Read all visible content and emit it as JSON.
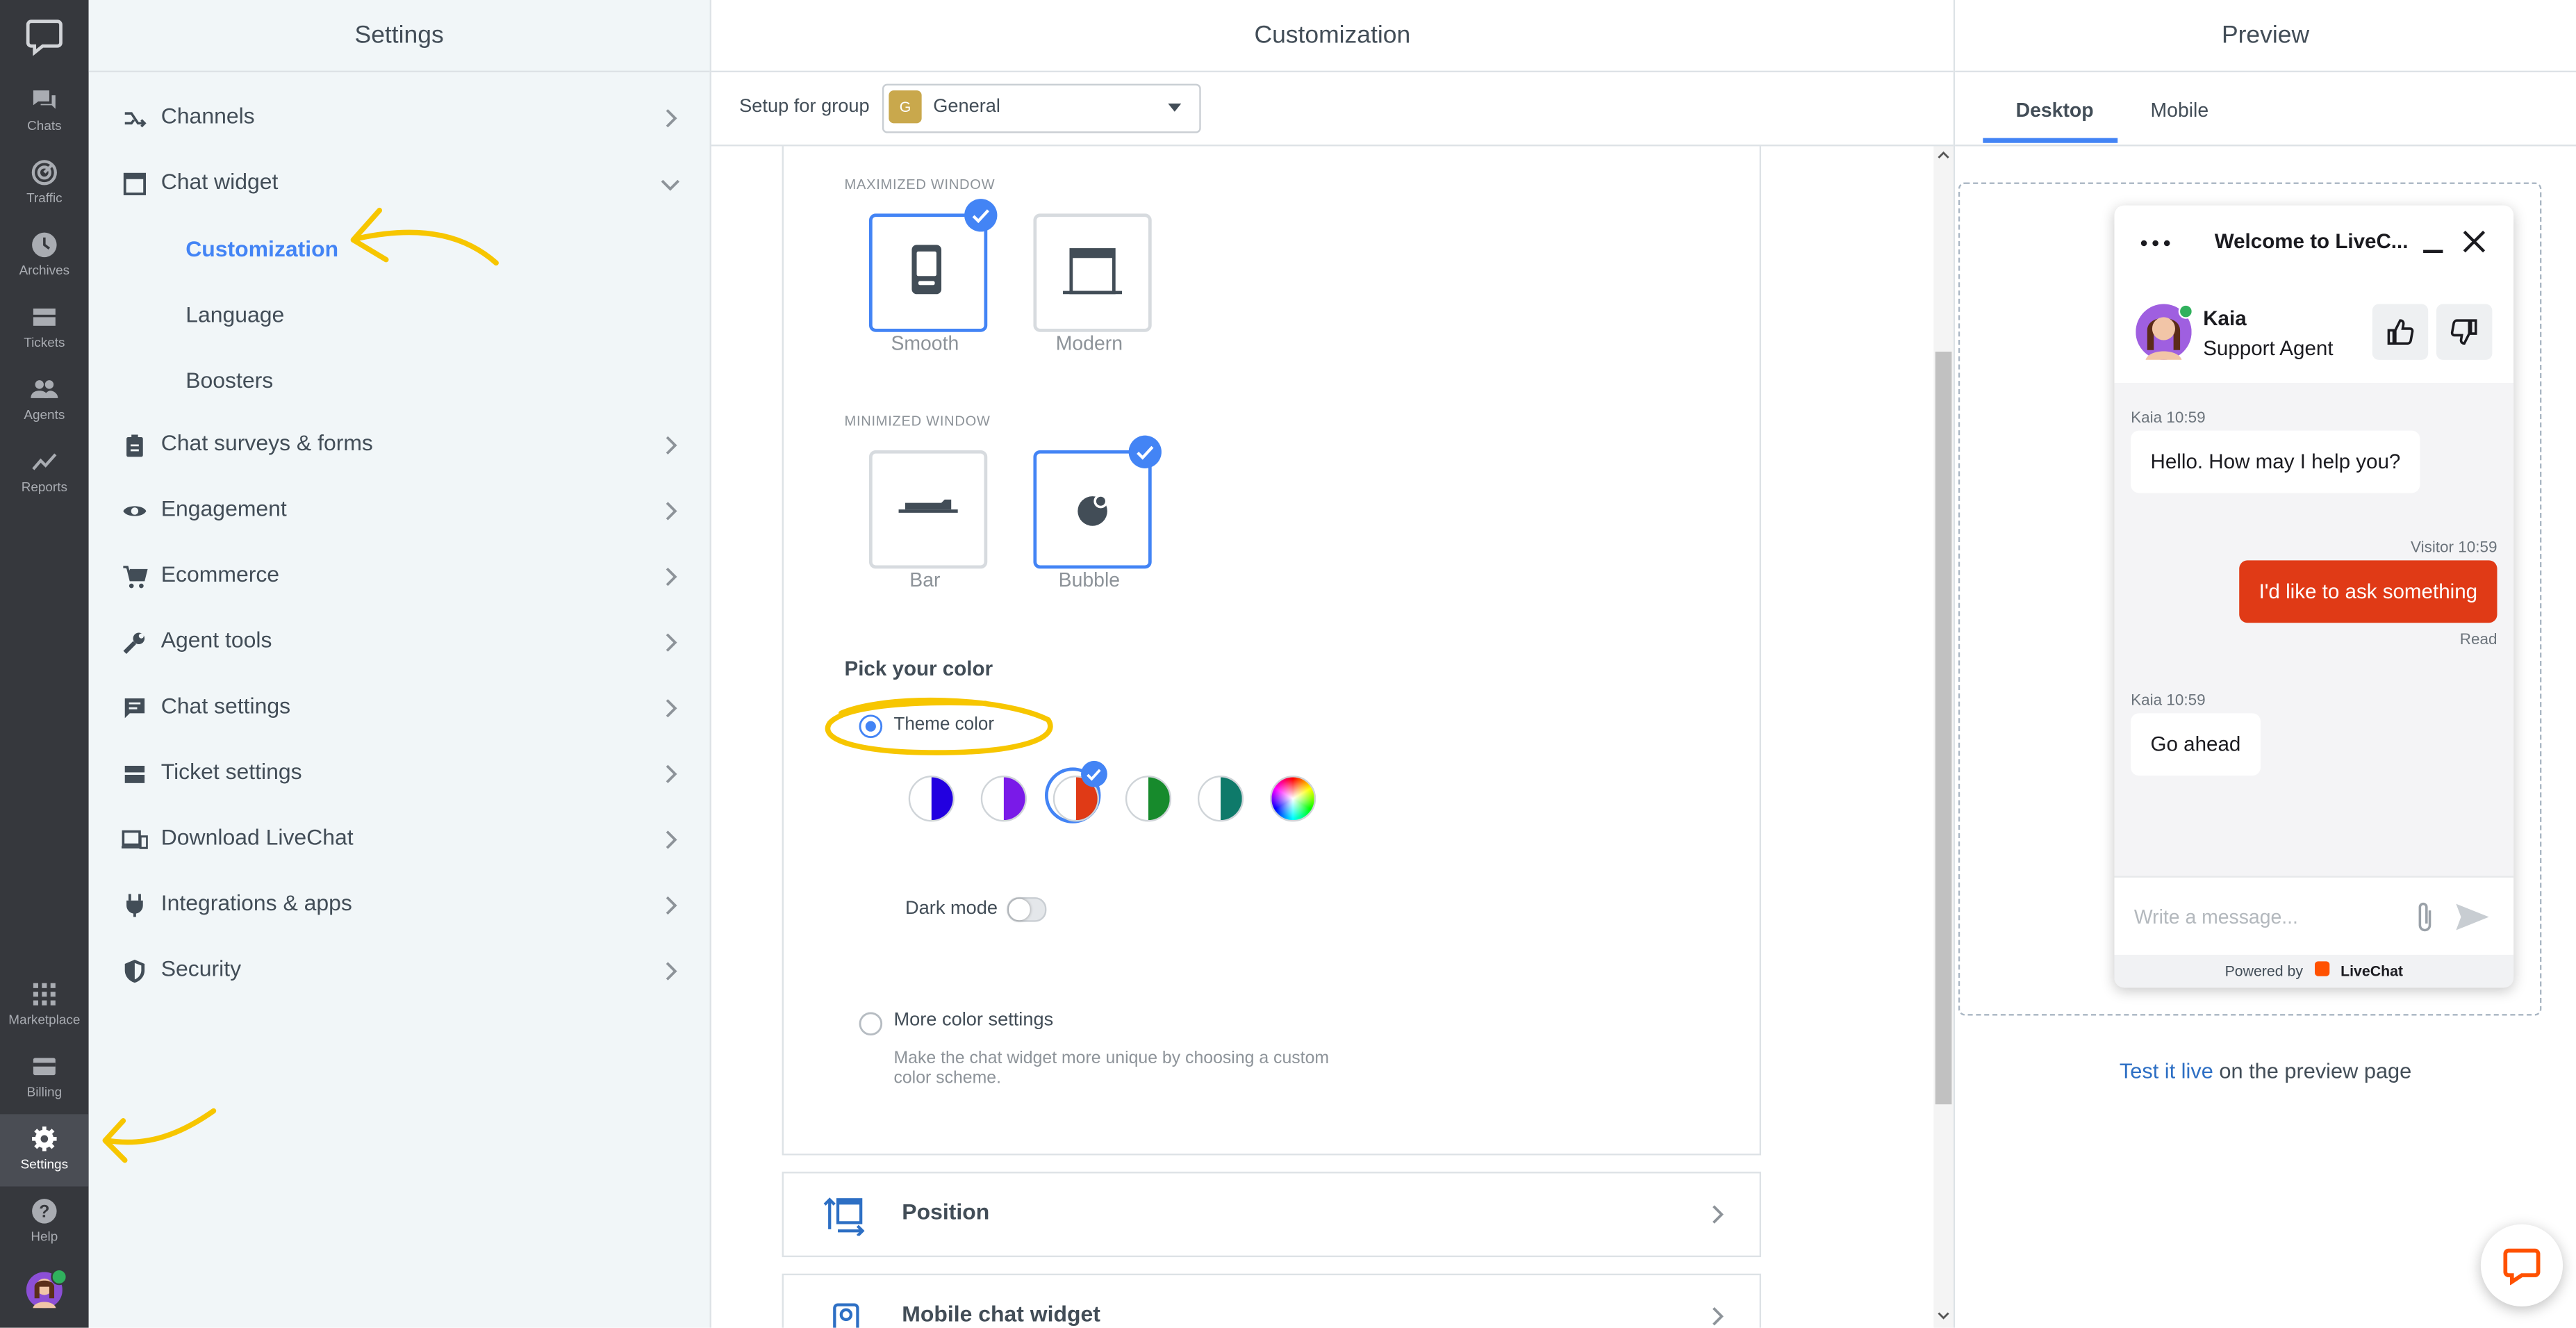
{
  "nav": {
    "items": [
      {
        "label": "Chats",
        "icon": "chats-icon"
      },
      {
        "label": "Traffic",
        "icon": "traffic-icon"
      },
      {
        "label": "Archives",
        "icon": "archives-icon"
      },
      {
        "label": "Tickets",
        "icon": "tickets-icon"
      },
      {
        "label": "Agents",
        "icon": "agents-icon"
      },
      {
        "label": "Reports",
        "icon": "reports-icon"
      },
      {
        "label": "Marketplace",
        "icon": "marketplace-icon"
      },
      {
        "label": "Billing",
        "icon": "billing-icon"
      },
      {
        "label": "Settings",
        "icon": "settings-icon"
      },
      {
        "label": "Help",
        "icon": "help-icon"
      }
    ]
  },
  "settings": {
    "title": "Settings",
    "menu": [
      {
        "label": "Channels",
        "icon": "channels-icon"
      },
      {
        "label": "Chat widget",
        "icon": "chat-widget-icon"
      },
      {
        "label": "Chat surveys & forms",
        "icon": "clipboard-icon"
      },
      {
        "label": "Engagement",
        "icon": "eye-icon"
      },
      {
        "label": "Ecommerce",
        "icon": "cart-icon"
      },
      {
        "label": "Agent tools",
        "icon": "wrench-icon"
      },
      {
        "label": "Chat settings",
        "icon": "chat-bubble-icon"
      },
      {
        "label": "Ticket settings",
        "icon": "ticket-icon"
      },
      {
        "label": "Download LiveChat",
        "icon": "devices-icon"
      },
      {
        "label": "Integrations & apps",
        "icon": "plug-icon"
      },
      {
        "label": "Security",
        "icon": "shield-icon"
      }
    ],
    "submenu": [
      "Customization",
      "Language",
      "Boosters"
    ]
  },
  "customization": {
    "title": "Customization",
    "group_label": "Setup for group",
    "group_value": "General",
    "group_badge": "G",
    "maximized_caption": "MAXIMIZED WINDOW",
    "maximized_options": [
      "Smooth",
      "Modern"
    ],
    "minimized_caption": "MINIMIZED WINDOW",
    "minimized_options": [
      "Bar",
      "Bubble"
    ],
    "pick_color": "Pick your color",
    "theme_color": "Theme color",
    "dark_mode": "Dark mode",
    "dark_mode_on": false,
    "more_colors": "More color settings",
    "more_colors_desc": "Make the chat widget more unique by choosing a custom color scheme.",
    "position": "Position",
    "mobile_widget": "Mobile chat widget",
    "swatches": [
      {
        "left": "#ffffff",
        "right": "#2200e0"
      },
      {
        "left": "#ffffff",
        "right": "#7a1ae8"
      },
      {
        "left": "#ffffff",
        "right": "#e03a16"
      },
      {
        "left": "#ffffff",
        "right": "#178a2c"
      },
      {
        "left": "#ffffff",
        "right": "#0e7a6a"
      }
    ]
  },
  "preview": {
    "title": "Preview",
    "tabs": [
      "Desktop",
      "Mobile"
    ],
    "widget": {
      "title": "Welcome to LiveC...",
      "agent_name": "Kaia",
      "agent_role": "Support Agent",
      "messages": [
        {
          "meta": "Kaia 10:59",
          "text": "Hello. How may I help you?"
        },
        {
          "meta": "Visitor 10:59",
          "text": "I'd like to ask something",
          "status": "Read"
        },
        {
          "meta": "Kaia 10:59",
          "text": "Go ahead"
        }
      ],
      "input_placeholder": "Write a message...",
      "powered_by": "Powered by",
      "brand": "LiveChat"
    },
    "test_link": "Test it live",
    "test_suffix": " on the preview page"
  },
  "colors": {
    "accent": "#4384f5",
    "theme": "#e03a16",
    "annotation": "#f7c600",
    "nav_bg": "#36383d"
  }
}
